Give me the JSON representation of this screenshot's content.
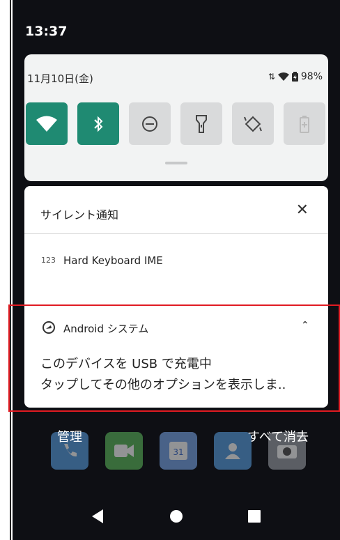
{
  "status_bar": {
    "time": "13:37"
  },
  "quick_settings": {
    "date": "11月10日(金)",
    "battery": "98%",
    "tiles": [
      {
        "name": "wifi-tile",
        "active": true
      },
      {
        "name": "bluetooth-tile",
        "active": true
      },
      {
        "name": "dnd-tile",
        "active": false
      },
      {
        "name": "flashlight-tile",
        "active": false
      },
      {
        "name": "rotate-tile",
        "active": false
      },
      {
        "name": "battery-saver-tile",
        "active": false
      }
    ]
  },
  "notifications": {
    "section_title": "サイレント通知",
    "keyboard": {
      "icon_label": "123",
      "text": "Hard Keyboard IME"
    },
    "system": {
      "app_name": "Android システム",
      "line1": "このデバイスを USB で充電中",
      "line2": "タップしてその他のオプションを表示しま.."
    }
  },
  "footer": {
    "manage": "管理",
    "clear_all": "すべて消去"
  },
  "colors": {
    "accent": "#1f8a72",
    "highlight": "#e11b22"
  }
}
